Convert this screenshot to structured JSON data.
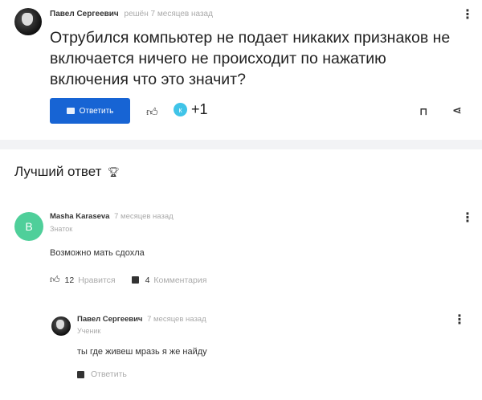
{
  "question": {
    "author": "Павел Сергеевич",
    "meta": "решён 7 месяцев назад",
    "text": "Отрубился компьютер не подает никаких признаков не включается ничего не происходит по нажатию включения что это значит?",
    "answer_button_label": "Ответить",
    "badge_letter": "к",
    "plus_count": "+1",
    "icons": {
      "menu": "kebab-menu-icon",
      "like": "thumbs-up-icon",
      "bookmark": "bookmark-icon",
      "share": "share-icon"
    }
  },
  "best_answer": {
    "title": "Лучший ответ",
    "icon": "trophy-icon",
    "avatar_letter": "В",
    "avatar_color": "#4fcf9a",
    "author": "Masha Karaseva",
    "meta": "7 месяцев назад",
    "role": "Знаток",
    "text": "Возможно мать сдохла",
    "likes_count": "12",
    "likes_label": "Нравится",
    "comments_count": "4",
    "comments_label": "Комментария"
  },
  "comment": {
    "author": "Павел Сергеевич",
    "meta": "7 месяцев назад",
    "role": "Ученик",
    "text": "ты где живеш мразь я же найду",
    "reply_label": "Ответить"
  },
  "colors": {
    "primary": "#1764d4",
    "badge": "#40c4e8",
    "muted": "#aaaaaa"
  }
}
